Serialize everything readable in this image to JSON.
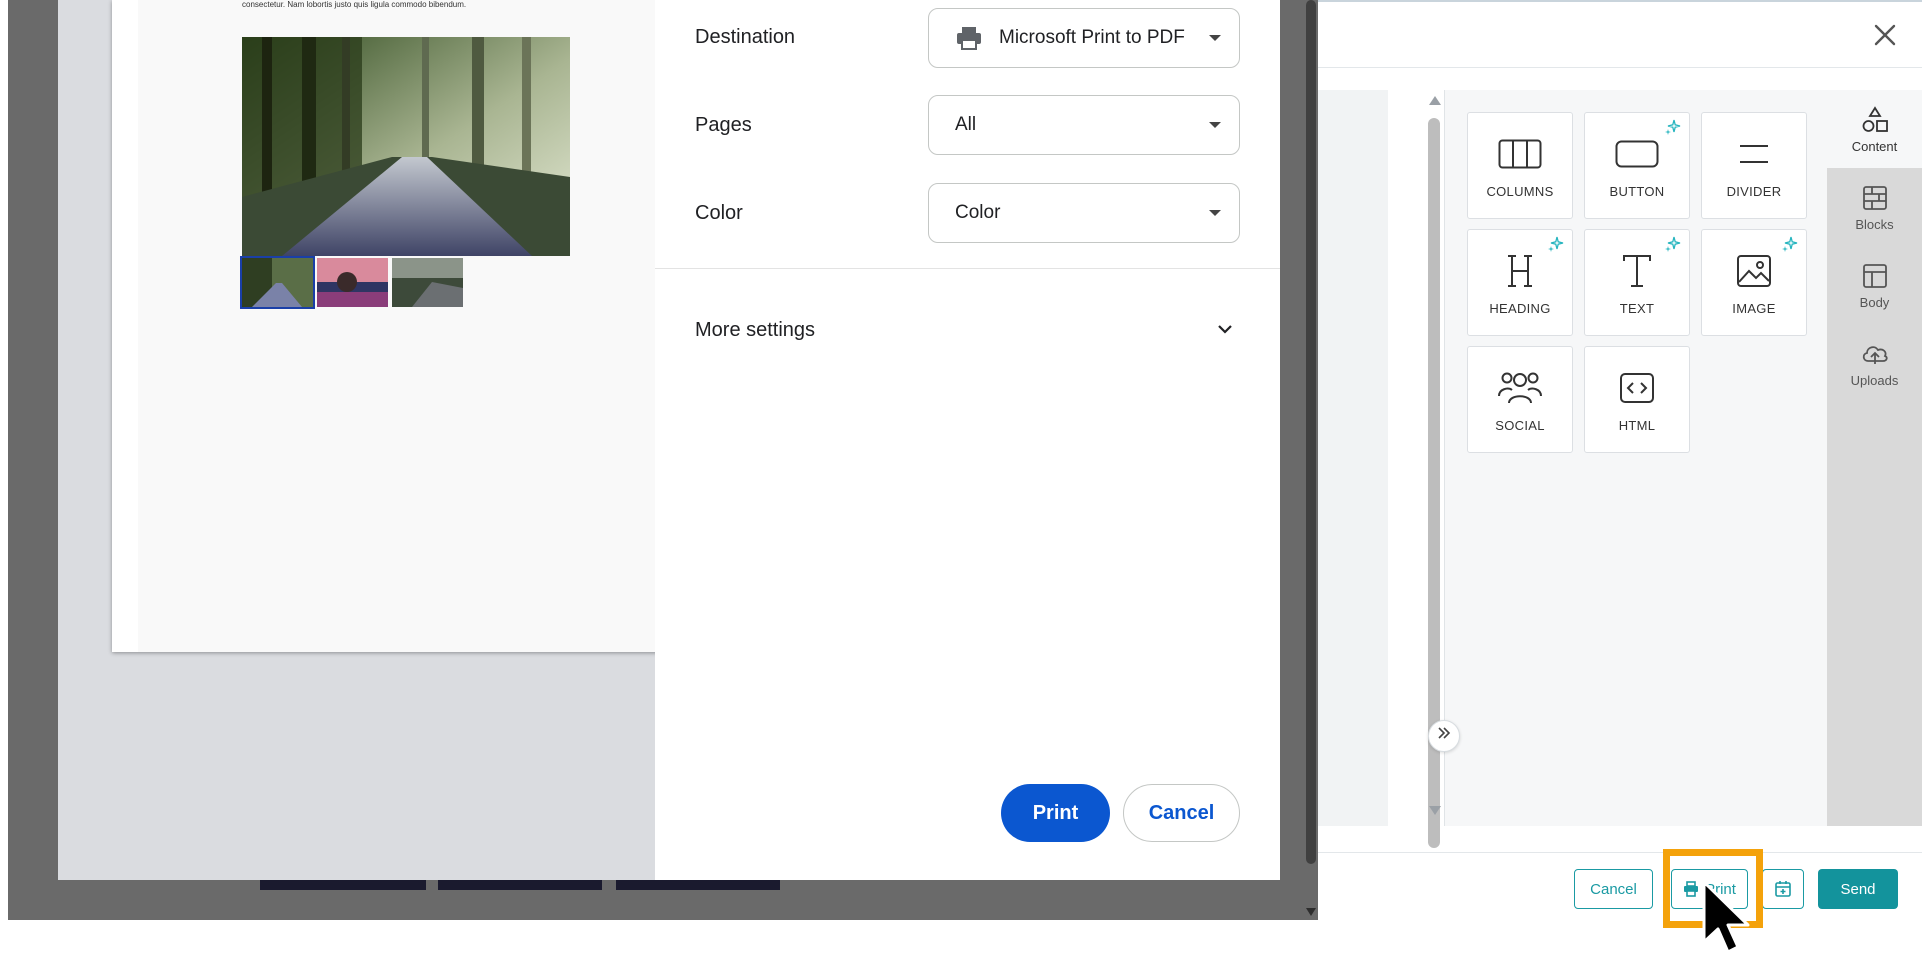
{
  "print_dialog": {
    "preview": {
      "page_text": "consectetur. Nam lobortis justo quis ligula commodo bibendum."
    },
    "settings": {
      "destination": {
        "label": "Destination",
        "value": "Microsoft Print to PDF"
      },
      "pages": {
        "label": "Pages",
        "value": "All"
      },
      "color": {
        "label": "Color",
        "value": "Color"
      },
      "more_settings_label": "More settings"
    },
    "print_label": "Print",
    "cancel_label": "Cancel"
  },
  "editor": {
    "close_icon": "close-icon",
    "tools": [
      {
        "label": "COLUMNS",
        "icon": "columns-icon",
        "ai": false
      },
      {
        "label": "BUTTON",
        "icon": "button-icon",
        "ai": true
      },
      {
        "label": "DIVIDER",
        "icon": "divider-icon",
        "ai": false
      },
      {
        "label": "HEADING",
        "icon": "heading-icon",
        "ai": true
      },
      {
        "label": "TEXT",
        "icon": "text-icon",
        "ai": true
      },
      {
        "label": "IMAGE",
        "icon": "image-icon",
        "ai": true
      },
      {
        "label": "SOCIAL",
        "icon": "social-icon",
        "ai": false
      },
      {
        "label": "HTML",
        "icon": "html-icon",
        "ai": false
      }
    ],
    "side_tabs": [
      {
        "label": "Content",
        "icon": "shapes-icon",
        "active": true
      },
      {
        "label": "Blocks",
        "icon": "blocks-icon",
        "active": false
      },
      {
        "label": "Body",
        "icon": "layout-icon",
        "active": false
      },
      {
        "label": "Uploads",
        "icon": "cloud-upload-icon",
        "active": false
      }
    ],
    "footer": {
      "cancel_label": "Cancel",
      "print_label": "Print",
      "send_label": "Send"
    }
  },
  "colors": {
    "accent_teal": "#13939c",
    "dialog_primary": "#0b57d0",
    "highlight": "#f4a20b"
  }
}
